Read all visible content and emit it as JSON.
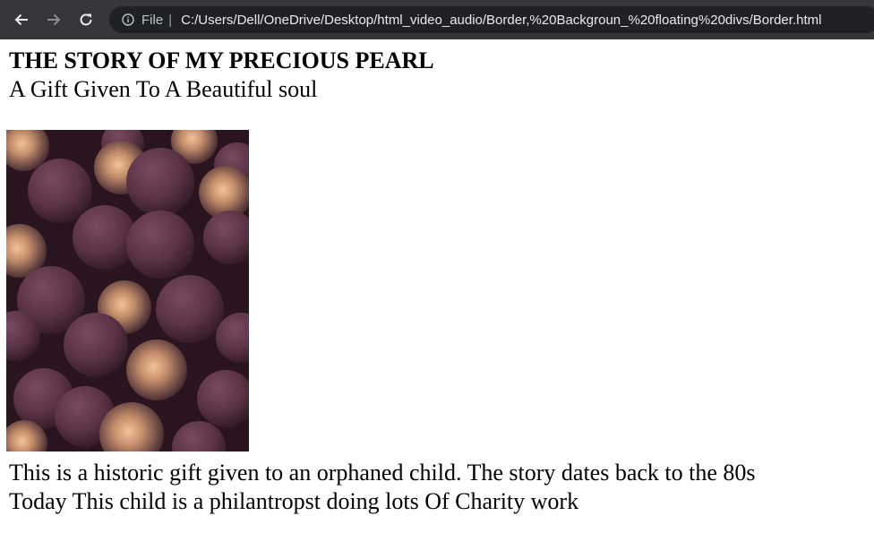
{
  "browser": {
    "scheme_label": "File",
    "separator": "|",
    "url": "C:/Users/Dell/OneDrive/Desktop/html_video_audio/Border,%20Backgroun_%20floating%20divs/Border.html"
  },
  "page": {
    "title": "THE STORY OF MY PRECIOUS PEARL",
    "subtitle": "A Gift Given To A Beautiful soul",
    "paragraph_line_1": "This is a historic gift given to an orphaned child. The story dates back to the 80s",
    "paragraph_line_2": "Today This child is a philantropst doing lots Of Charity work"
  },
  "colors": {
    "toolbar": "#35363a",
    "omnibox": "#202124",
    "sphere_matte": "#5b3346",
    "sphere_gold": "#d4a27c",
    "image_shadow": "#2a141f"
  },
  "icons": {
    "back": "arrow-left-icon",
    "forward": "arrow-right-icon",
    "reload": "reload-icon",
    "site_info": "info-icon"
  }
}
